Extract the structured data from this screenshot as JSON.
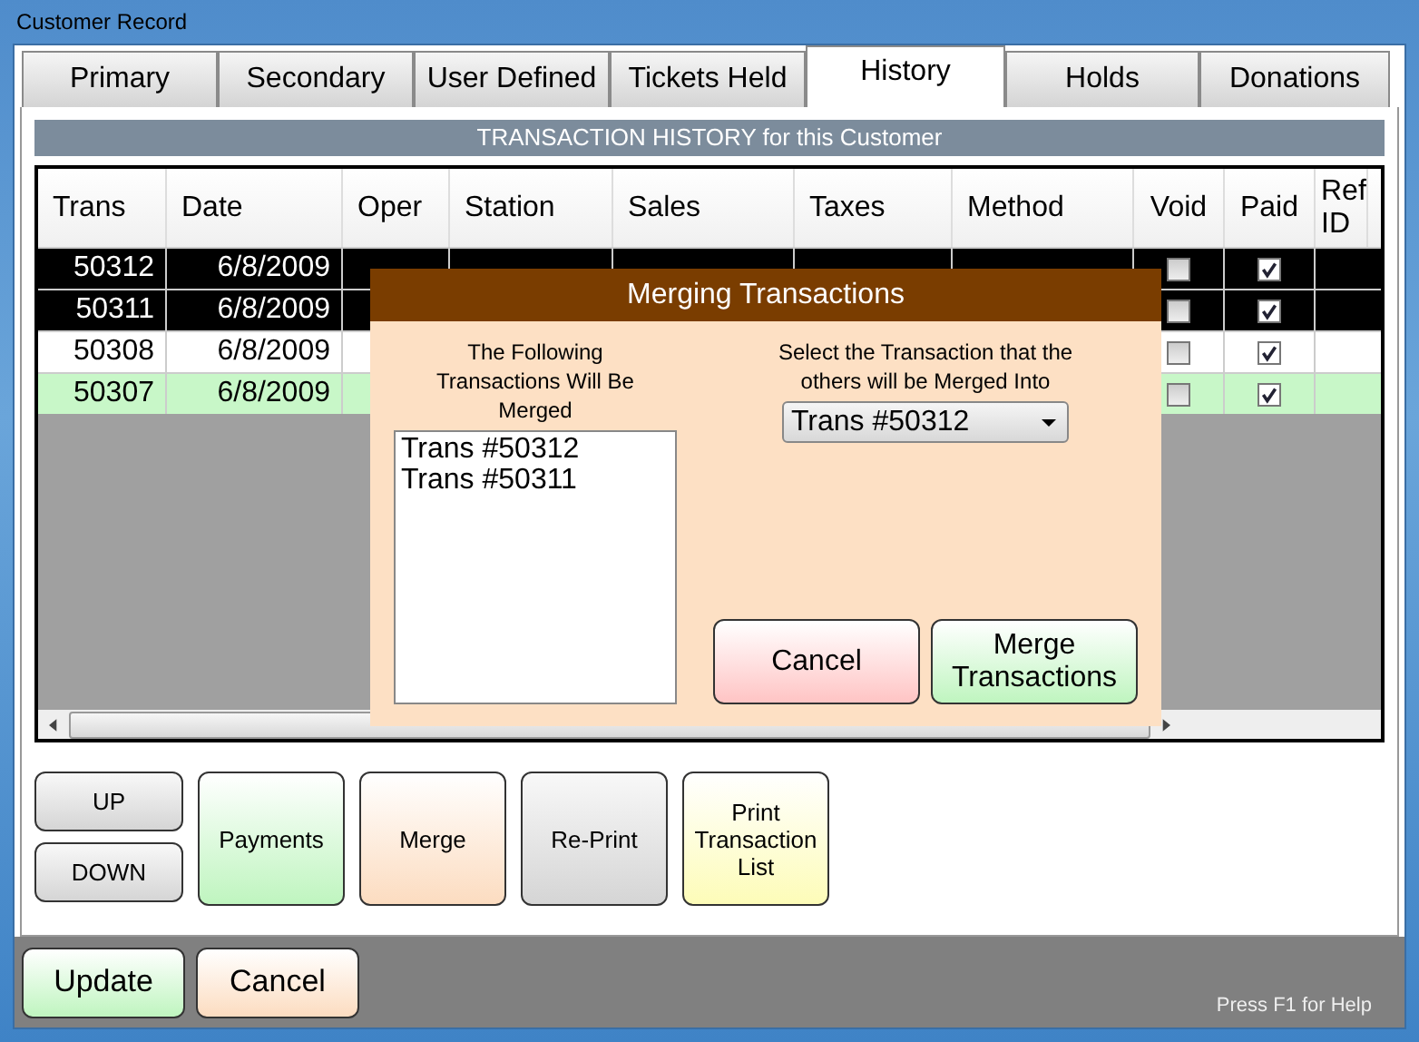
{
  "window": {
    "title": "Customer Record"
  },
  "tabs": [
    {
      "label": "Primary",
      "selected": false
    },
    {
      "label": "Secondary",
      "selected": false
    },
    {
      "label": "User Defined",
      "selected": false
    },
    {
      "label": "Tickets Held",
      "selected": false
    },
    {
      "label": "History",
      "selected": true
    },
    {
      "label": "Holds",
      "selected": false
    },
    {
      "label": "Donations",
      "selected": false
    }
  ],
  "section_title": "TRANSACTION HISTORY for this Customer",
  "table": {
    "columns": [
      "Trans",
      "Date",
      "Oper",
      "Station",
      "Sales",
      "Taxes",
      "Method",
      "Void",
      "Paid",
      "Ref ID"
    ],
    "rows": [
      {
        "trans": "50312",
        "date": "6/8/2009",
        "void": false,
        "paid": true,
        "selected": true
      },
      {
        "trans": "50311",
        "date": "6/8/2009",
        "void": false,
        "paid": true,
        "selected": true
      },
      {
        "trans": "50308",
        "date": "6/8/2009",
        "void": false,
        "paid": true,
        "selected": false,
        "color": "#ffffff"
      },
      {
        "trans": "50307",
        "date": "6/8/2009",
        "void": false,
        "paid": true,
        "selected": false,
        "color": "#c8f7c8"
      }
    ]
  },
  "dialog": {
    "title": "Merging Transactions",
    "left_label": "The Following Transactions Will Be Merged",
    "items": [
      "Trans #50312",
      "Trans #50311"
    ],
    "right_label": "Select the Transaction that the others will be Merged Into",
    "target": "Trans #50312",
    "buttons": [
      {
        "label": "Cancel",
        "kind": "cancel"
      },
      {
        "label": "Merge Transactions",
        "kind": "confirm"
      }
    ]
  },
  "actions": [
    {
      "label": "Payments",
      "kind": "green"
    },
    {
      "label": "Merge",
      "kind": "orange"
    },
    {
      "label": "Re-Print",
      "kind": "gray"
    },
    {
      "label": "Print Transaction List",
      "kind": "yellow"
    }
  ],
  "nav": [
    "UP",
    "DOWN"
  ],
  "footer": {
    "buttons": [
      {
        "label": "Update",
        "kind": "green"
      },
      {
        "label": "Cancel",
        "kind": "orange"
      }
    ],
    "help": "Press F1 for Help"
  }
}
